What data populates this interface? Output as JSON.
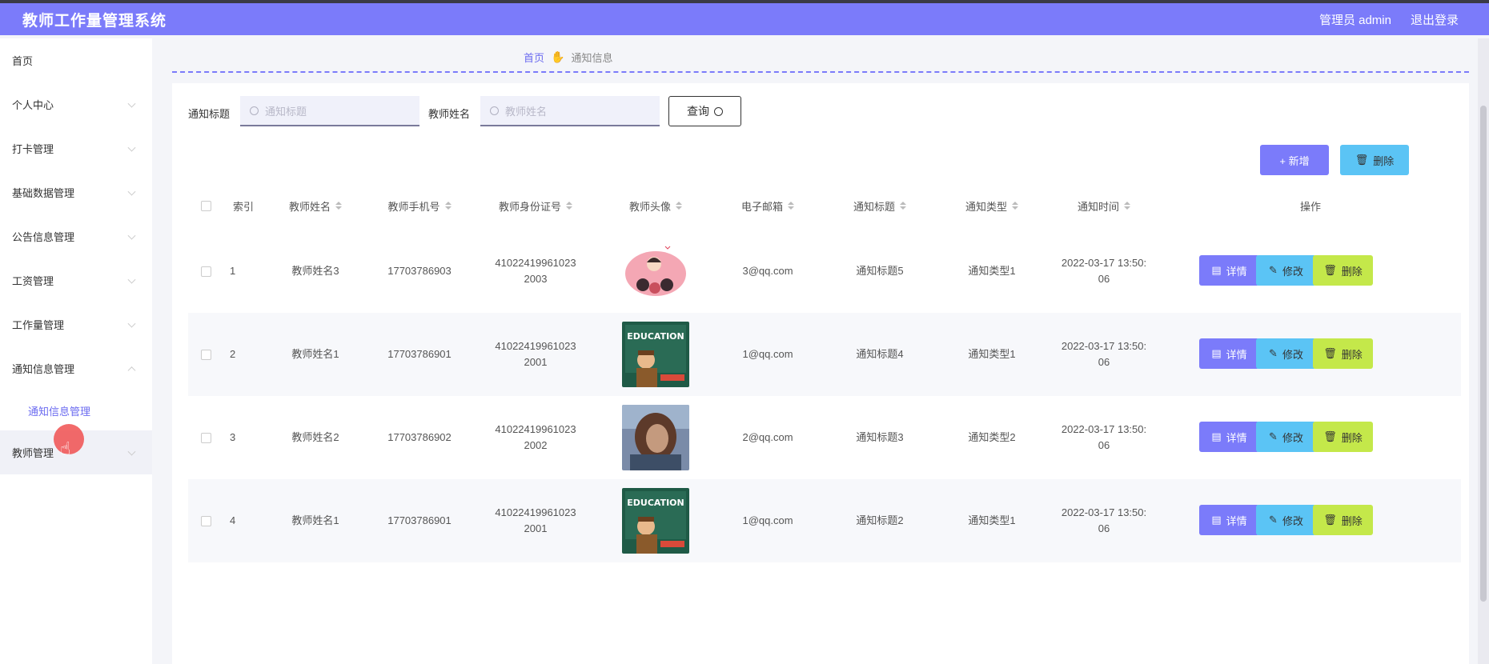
{
  "header": {
    "title": "教师工作量管理系统",
    "user": "管理员 admin",
    "logout": "退出登录"
  },
  "sidebar": {
    "items": [
      {
        "label": "首页"
      },
      {
        "label": "个人中心"
      },
      {
        "label": "打卡管理"
      },
      {
        "label": "基础数据管理"
      },
      {
        "label": "公告信息管理"
      },
      {
        "label": "工资管理"
      },
      {
        "label": "工作量管理"
      },
      {
        "label": "通知信息管理"
      }
    ],
    "sub_item": "通知信息管理",
    "last_item": "教师管理"
  },
  "breadcrumb": {
    "home": "首页",
    "current": "通知信息"
  },
  "search": {
    "title_label": "通知标题",
    "title_placeholder": "通知标题",
    "name_label": "教师姓名",
    "name_placeholder": "教师姓名",
    "query_button": "查询"
  },
  "toolbar": {
    "add": "+ 新增",
    "delete": "删除"
  },
  "table": {
    "headers": [
      "索引",
      "教师姓名",
      "教师手机号",
      "教师身份证号",
      "教师头像",
      "电子邮箱",
      "通知标题",
      "通知类型",
      "通知时间",
      "操作"
    ],
    "rows": [
      {
        "index": "1",
        "name": "教师姓名3",
        "phone": "17703786903",
        "id1": "41022419961023",
        "id2": "2003",
        "avatar": "pink",
        "email": "3@qq.com",
        "title": "通知标题5",
        "type": "通知类型1",
        "time1": "2022-03-17 13:50:",
        "time2": "06"
      },
      {
        "index": "2",
        "name": "教师姓名1",
        "phone": "17703786901",
        "id1": "41022419961023",
        "id2": "2001",
        "avatar": "education",
        "email": "1@qq.com",
        "title": "通知标题4",
        "type": "通知类型1",
        "time1": "2022-03-17 13:50:",
        "time2": "06"
      },
      {
        "index": "3",
        "name": "教师姓名2",
        "phone": "17703786902",
        "id1": "41022419961023",
        "id2": "2002",
        "avatar": "photo",
        "email": "2@qq.com",
        "title": "通知标题3",
        "type": "通知类型2",
        "time1": "2022-03-17 13:50:",
        "time2": "06"
      },
      {
        "index": "4",
        "name": "教师姓名1",
        "phone": "17703786901",
        "id1": "41022419961023",
        "id2": "2001",
        "avatar": "education",
        "email": "1@qq.com",
        "title": "通知标题2",
        "type": "通知类型1",
        "time1": "2022-03-17 13:50:",
        "time2": "06"
      }
    ],
    "actions": {
      "view": "详情",
      "edit": "修改",
      "remove": "删除"
    }
  },
  "avatar_text": {
    "education": "EDUCATION"
  },
  "colors": {
    "accent": "#7b7bfa",
    "info": "#5bc4f5",
    "lime": "#c4e84a",
    "link": "#6b6bf0"
  }
}
